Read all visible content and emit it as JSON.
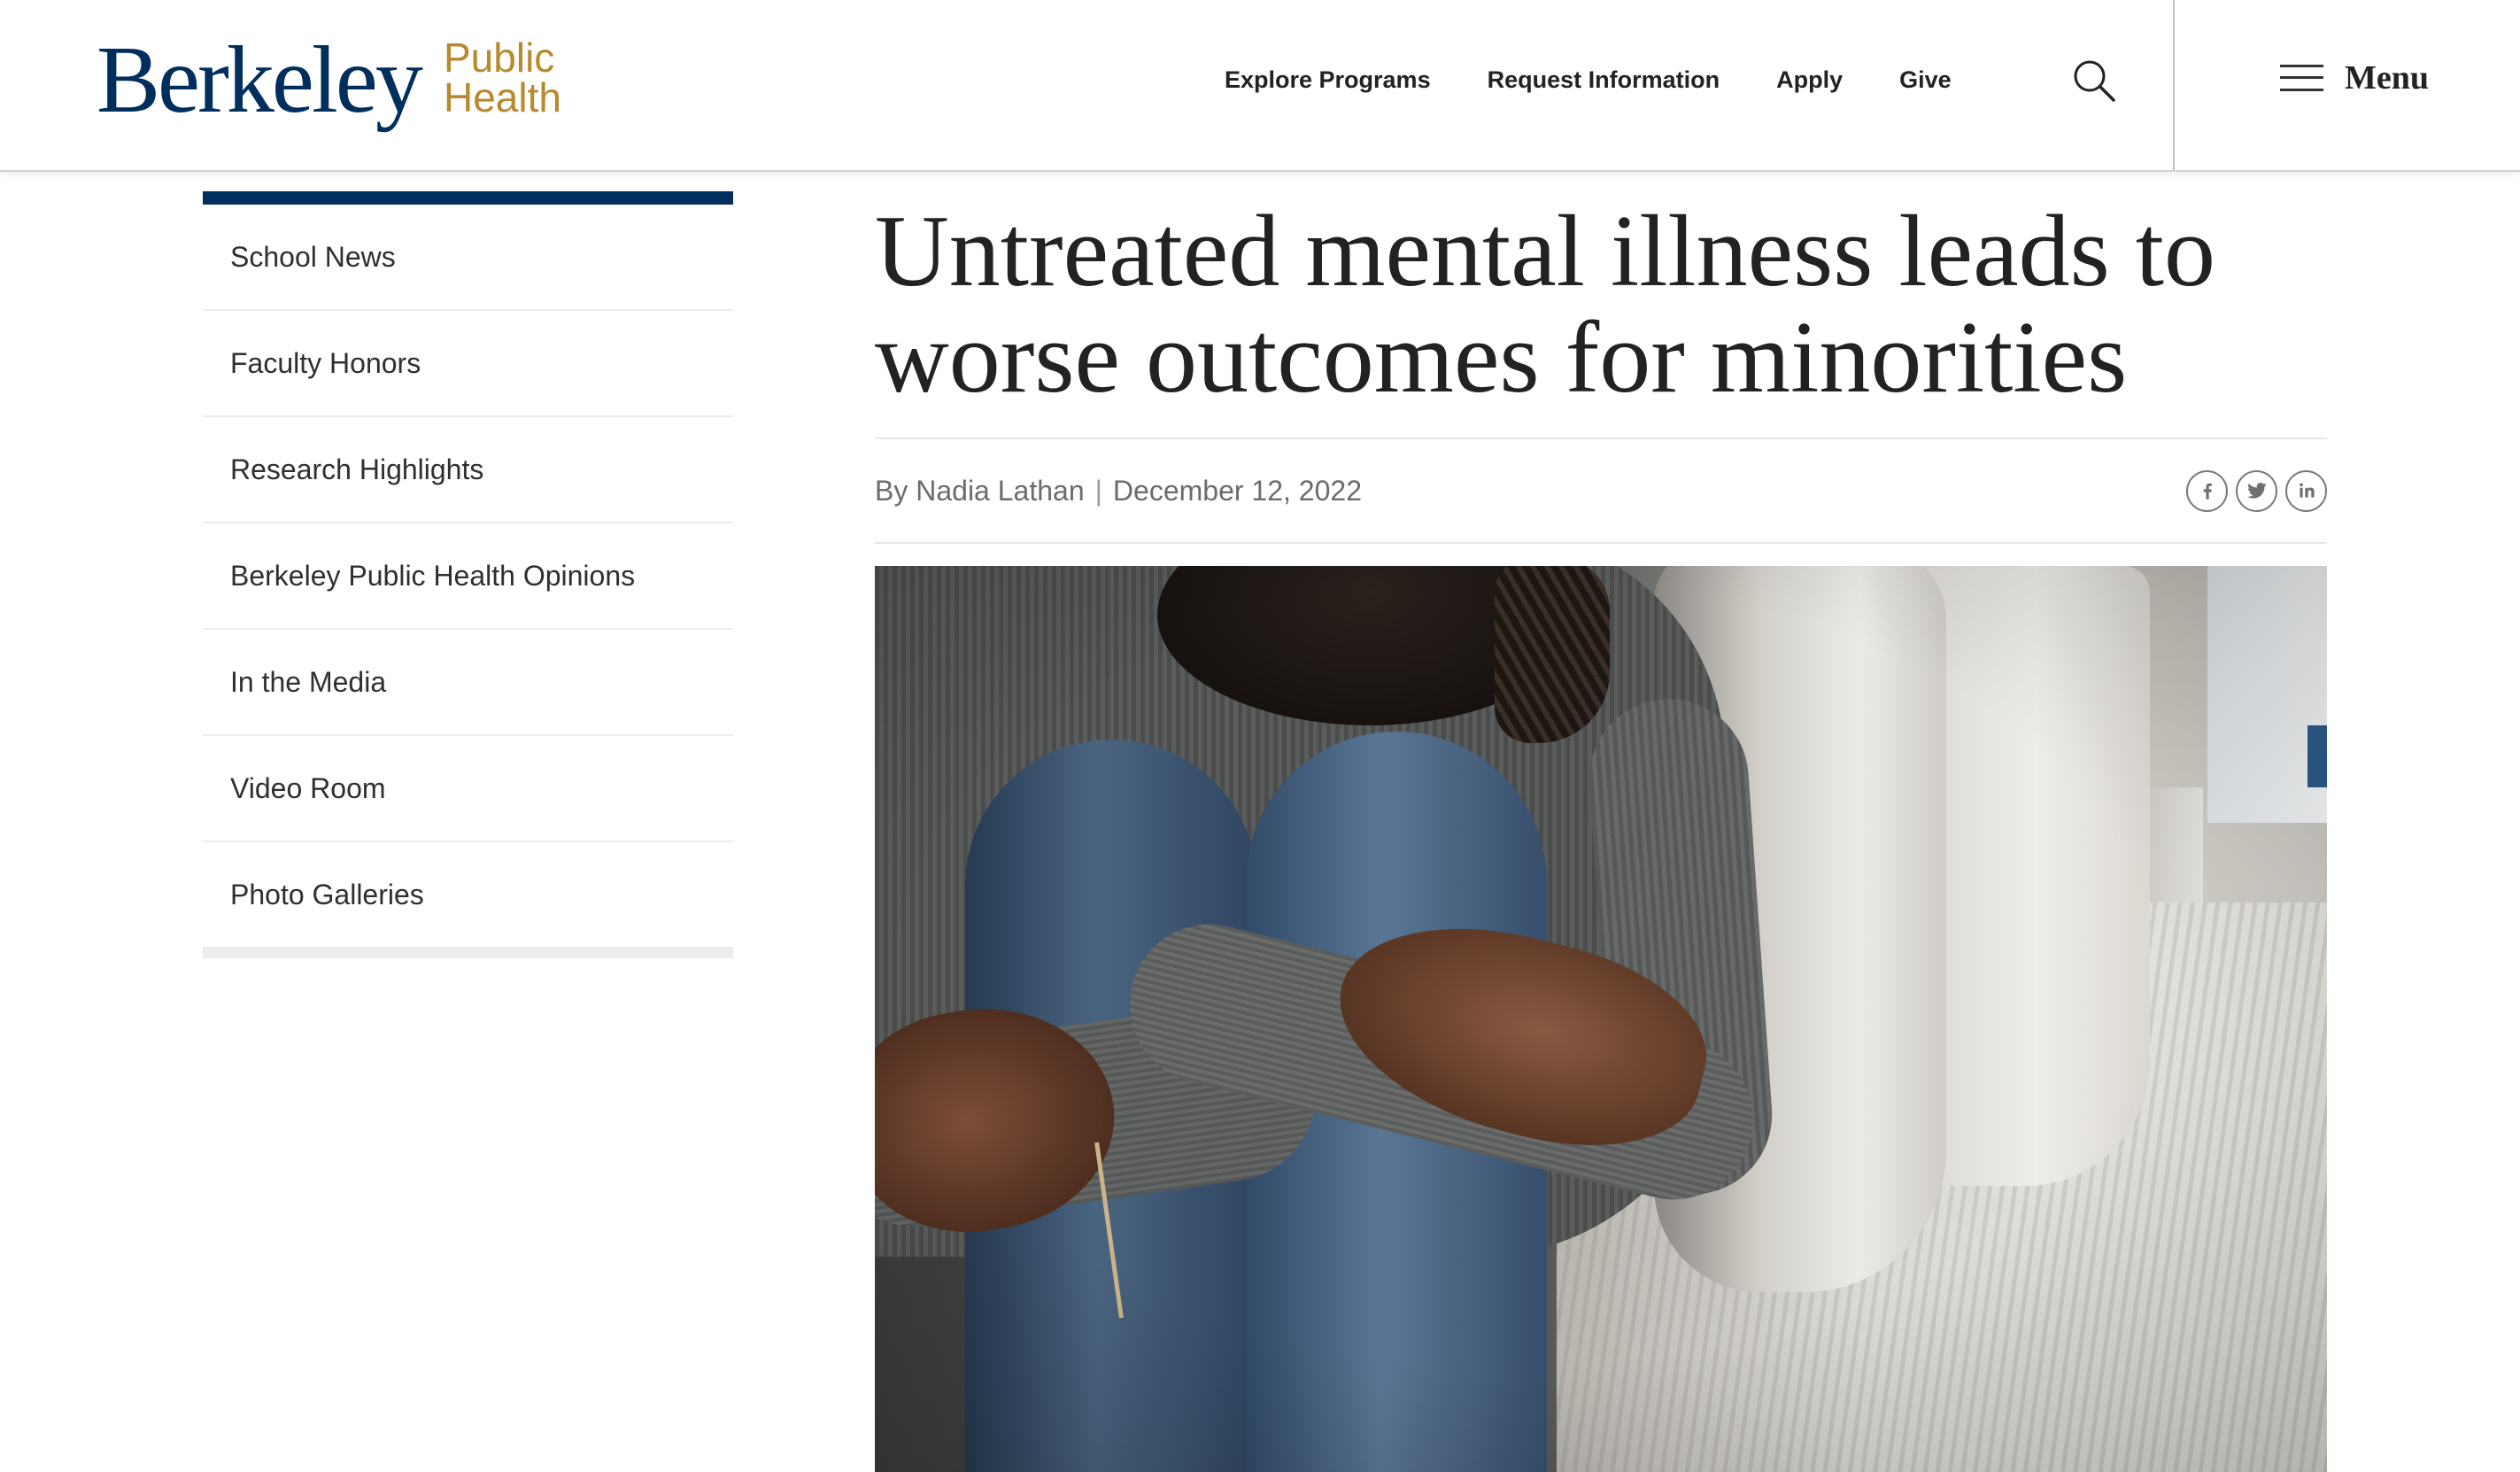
{
  "header": {
    "logo": {
      "wordmark": "Berkeley",
      "sub_line1": "Public",
      "sub_line2": "Health"
    },
    "nav": [
      {
        "label": "Explore Programs"
      },
      {
        "label": "Request Information"
      },
      {
        "label": "Apply"
      },
      {
        "label": "Give"
      }
    ],
    "search": {
      "icon": "search-icon"
    },
    "menu": {
      "icon": "hamburger-icon",
      "label": "Menu"
    }
  },
  "sidebar": {
    "items": [
      {
        "label": "School News"
      },
      {
        "label": "Faculty Honors"
      },
      {
        "label": "Research Highlights"
      },
      {
        "label": "Berkeley Public Health Opinions"
      },
      {
        "label": "In the Media"
      },
      {
        "label": "Video Room"
      },
      {
        "label": "Photo Galleries"
      }
    ]
  },
  "article": {
    "title": "Untreated mental illness leads to worse outcomes for minorities",
    "byline": {
      "author": "By Nadia Lathan",
      "separator": "|",
      "date": "December 12, 2022"
    },
    "share": [
      {
        "icon": "facebook-icon"
      },
      {
        "icon": "twitter-icon"
      },
      {
        "icon": "linkedin-icon"
      }
    ]
  },
  "colors": {
    "brand_blue": "#002E5D",
    "brand_gold": "#B8892E",
    "heading_text": "#222222",
    "muted_text": "#6B6B6B",
    "divider": "#E6E6E6"
  }
}
